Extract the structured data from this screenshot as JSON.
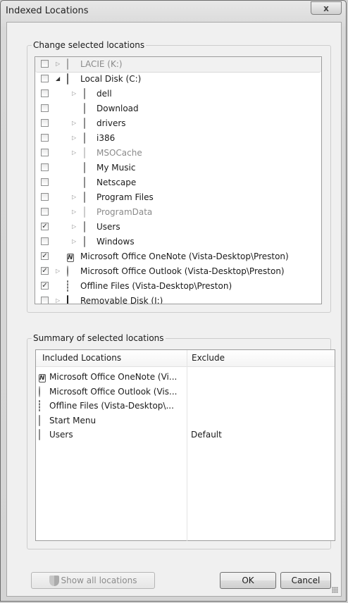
{
  "window": {
    "title": "Indexed Locations",
    "close_glyph": "x"
  },
  "change_group": {
    "label": "Change selected locations",
    "rows": [
      {
        "label": "LACIE (K:)",
        "checked": false,
        "expander": "closed",
        "indent": 0,
        "icon": "external-drive-icon",
        "gray": true
      },
      {
        "label": "Local Disk (C:)",
        "checked": false,
        "expander": "open",
        "indent": 0,
        "icon": "hard-disk-icon",
        "gray": false
      },
      {
        "label": "dell",
        "checked": false,
        "expander": "closed",
        "indent": 1,
        "icon": "folder-icon",
        "gray": false
      },
      {
        "label": "Download",
        "checked": false,
        "expander": "none",
        "indent": 1,
        "icon": "folder-icon",
        "gray": false
      },
      {
        "label": "drivers",
        "checked": false,
        "expander": "closed",
        "indent": 1,
        "icon": "folder-icon",
        "gray": false
      },
      {
        "label": "i386",
        "checked": false,
        "expander": "closed",
        "indent": 1,
        "icon": "folder-icon",
        "gray": false
      },
      {
        "label": "MSOCache",
        "checked": false,
        "expander": "closed",
        "indent": 1,
        "icon": "folder-icon",
        "gray": true
      },
      {
        "label": "My Music",
        "checked": false,
        "expander": "none",
        "indent": 1,
        "icon": "folder-icon",
        "gray": false
      },
      {
        "label": "Netscape",
        "checked": false,
        "expander": "none",
        "indent": 1,
        "icon": "folder-icon",
        "gray": false
      },
      {
        "label": "Program Files",
        "checked": false,
        "expander": "closed",
        "indent": 1,
        "icon": "folder-icon",
        "gray": false
      },
      {
        "label": "ProgramData",
        "checked": false,
        "expander": "closed",
        "indent": 1,
        "icon": "folder-icon",
        "gray": true
      },
      {
        "label": "Users",
        "checked": true,
        "expander": "closed",
        "indent": 1,
        "icon": "folder-icon",
        "gray": false
      },
      {
        "label": "Windows",
        "checked": false,
        "expander": "closed",
        "indent": 1,
        "icon": "folder-icon",
        "gray": false
      },
      {
        "label": "Microsoft Office OneNote (Vista-Desktop\\Preston)",
        "checked": true,
        "expander": "none",
        "indent": 0,
        "icon": "onenote-icon",
        "gray": false
      },
      {
        "label": "Microsoft Office Outlook (Vista-Desktop\\Preston)",
        "checked": true,
        "expander": "closed",
        "indent": 0,
        "icon": "outlook-icon",
        "gray": false
      },
      {
        "label": "Offline Files (Vista-Desktop\\Preston)",
        "checked": true,
        "expander": "none",
        "indent": 0,
        "icon": "offline-files-icon",
        "gray": false
      },
      {
        "label": "Removable Disk (J:)",
        "checked": false,
        "expander": "closed",
        "indent": 0,
        "icon": "removable-disk-icon",
        "gray": false
      }
    ]
  },
  "summary_group": {
    "label": "Summary of selected locations",
    "col_included": "Included Locations",
    "col_exclude": "Exclude",
    "rows": [
      {
        "label": "Microsoft Office OneNote (Vi...",
        "exclude": "",
        "icon": "onenote-icon"
      },
      {
        "label": "Microsoft Office Outlook (Vis...",
        "exclude": "",
        "icon": "outlook-icon"
      },
      {
        "label": "Offline Files (Vista-Desktop\\...",
        "exclude": "",
        "icon": "offline-files-icon"
      },
      {
        "label": "Start Menu",
        "exclude": "",
        "icon": "folder-icon"
      },
      {
        "label": "Users",
        "exclude": "Default",
        "icon": "folder-icon"
      }
    ]
  },
  "buttons": {
    "show_all": "Show all locations",
    "ok": "OK",
    "cancel": "Cancel"
  }
}
